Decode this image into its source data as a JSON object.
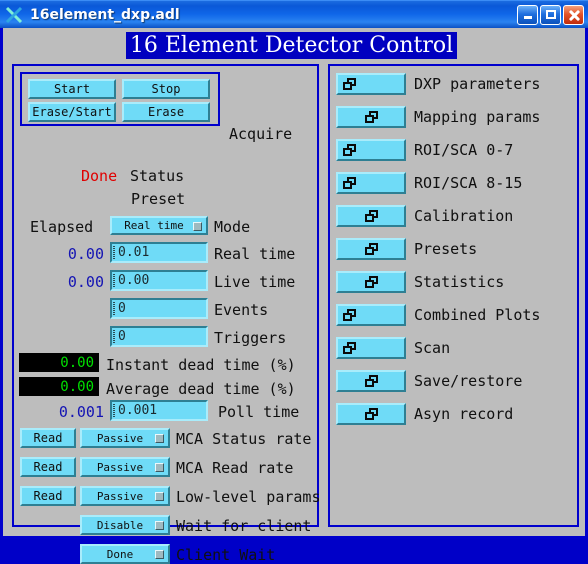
{
  "window": {
    "title": "16element_dxp.adl",
    "icon": "x-window-icon",
    "buttons": {
      "minimize": "minimize-icon",
      "maximize": "maximize-icon",
      "close": "close-icon"
    }
  },
  "banner": {
    "title": "16 Element Detector Control"
  },
  "colors": {
    "panel_border": "#0000cd",
    "widget_blue": "#6fdbf7",
    "value_blue": "#1414b4",
    "status_red": "#e00000",
    "meter_green": "#00e000",
    "banner_bg": "#0000c0",
    "background": "#bdbdbd"
  },
  "left_panel": {
    "acquire_group": {
      "label": "Acquire",
      "buttons": [
        {
          "label": "Start"
        },
        {
          "label": "Stop"
        },
        {
          "label": "Erase/Start"
        },
        {
          "label": "Erase"
        }
      ]
    },
    "status": {
      "value": "Done",
      "label": "Status"
    },
    "preset_header": "Preset",
    "elapsed_header": "Elapsed",
    "mode": {
      "value": "Real time",
      "label": "Mode"
    },
    "rows": [
      {
        "readback": "0.00",
        "entry": "0.01",
        "label": "Real time"
      },
      {
        "readback": "0.00",
        "entry": "0.00",
        "label": "Live time"
      },
      {
        "readback": "",
        "entry": "0",
        "label": "Events"
      },
      {
        "readback": "",
        "entry": "0",
        "label": "Triggers"
      }
    ],
    "meters": [
      {
        "value": "0.00",
        "label": "Instant dead time (%)"
      },
      {
        "value": "0.00",
        "label": "Average dead time (%)"
      }
    ],
    "poll_time": {
      "readback": "0.001",
      "entry": "0.001",
      "label": "Poll time"
    },
    "rate_rows": [
      {
        "button": "Read",
        "menu": "Passive",
        "label": "MCA Status rate"
      },
      {
        "button": "Read",
        "menu": "Passive",
        "label": "MCA Read rate"
      },
      {
        "button": "Read",
        "menu": "Passive",
        "label": "Low-level params"
      }
    ],
    "menu_rows": [
      {
        "menu": "Disable",
        "label": "Wait for client"
      },
      {
        "menu": "Done",
        "label": "Client Wait"
      }
    ]
  },
  "right_panel": {
    "items": [
      {
        "label": "DXP parameters",
        "icon": "related-display-icon",
        "icon_align": "left"
      },
      {
        "label": "Mapping params",
        "icon": "related-display-icon",
        "icon_align": "center"
      },
      {
        "label": "ROI/SCA 0-7",
        "icon": "related-display-icon",
        "icon_align": "left"
      },
      {
        "label": "ROI/SCA 8-15",
        "icon": "related-display-icon",
        "icon_align": "left"
      },
      {
        "label": "Calibration",
        "icon": "related-display-icon",
        "icon_align": "center"
      },
      {
        "label": "Presets",
        "icon": "related-display-icon",
        "icon_align": "center"
      },
      {
        "label": "Statistics",
        "icon": "related-display-icon",
        "icon_align": "center"
      },
      {
        "label": "Combined Plots",
        "icon": "related-display-icon",
        "icon_align": "left"
      },
      {
        "label": "Scan",
        "icon": "related-display-icon",
        "icon_align": "left"
      },
      {
        "label": "Save/restore",
        "icon": "related-display-icon",
        "icon_align": "center"
      },
      {
        "label": "Asyn record",
        "icon": "related-display-icon",
        "icon_align": "center"
      }
    ]
  }
}
